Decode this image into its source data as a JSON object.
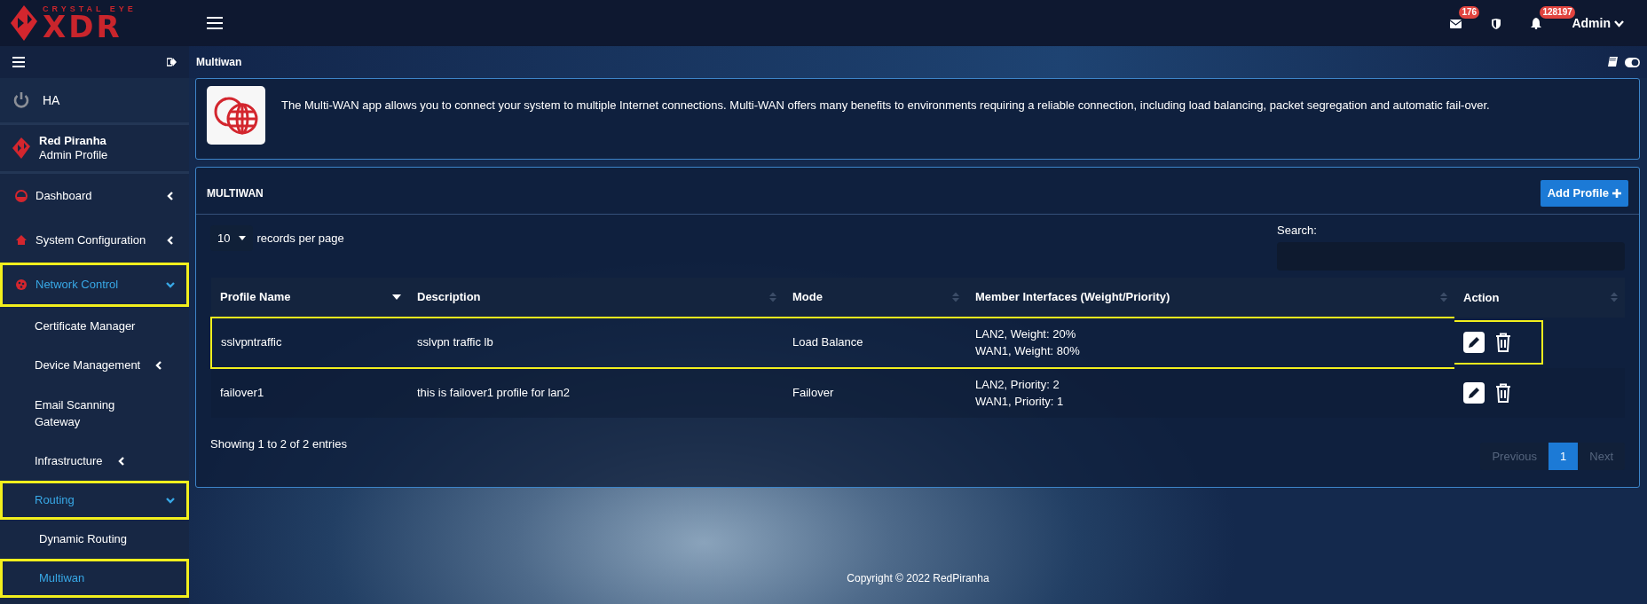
{
  "logo": {
    "tagline": "CRYSTAL EYE",
    "wordmark": "XDR"
  },
  "topbar": {
    "notifications": [
      {
        "kind": "mail",
        "count": "176"
      },
      {
        "kind": "shield"
      },
      {
        "kind": "bell",
        "count": "128197"
      }
    ],
    "user": "Admin"
  },
  "sidebar": {
    "ha_label": "HA",
    "profile": {
      "name": "Red Piranha",
      "role": "Admin Profile"
    },
    "items": [
      {
        "label": "Dashboard",
        "expanded": false,
        "selected": false,
        "highlighted": false
      },
      {
        "label": "System Configuration",
        "expanded": false,
        "selected": false,
        "highlighted": false
      },
      {
        "label": "Network Control",
        "expanded": true,
        "selected": true,
        "highlighted": true,
        "children": [
          {
            "label": "Certificate Manager",
            "selected": false,
            "highlighted": false
          },
          {
            "label": "Device Management",
            "expanded": false,
            "selected": false,
            "highlighted": false
          },
          {
            "label": "Email Scanning Gateway",
            "selected": false,
            "highlighted": false
          },
          {
            "label": "Infrastructure",
            "expanded": false,
            "selected": false,
            "highlighted": false
          },
          {
            "label": "Routing",
            "expanded": true,
            "selected": true,
            "highlighted": true,
            "children": [
              {
                "label": "Dynamic Routing",
                "selected": false,
                "highlighted": false
              },
              {
                "label": "Multiwan",
                "selected": true,
                "highlighted": true
              }
            ]
          }
        ]
      }
    ]
  },
  "page": {
    "title": "Multiwan",
    "info": "The Multi-WAN app allows you to connect your system to multiple Internet connections. Multi-WAN offers many benefits to environments requiring a reliable connection, including load balancing, packet segregation and automatic fail-over.",
    "panel": {
      "title": "MULTIWAN",
      "add_button": "Add Profile",
      "page_length": "10",
      "page_length_label": "records per page",
      "search_label": "Search:",
      "columns": [
        {
          "label": "Profile Name",
          "sorted": true
        },
        {
          "label": "Description",
          "sorted": false
        },
        {
          "label": "Mode",
          "sorted": false
        },
        {
          "label": "Member Interfaces (Weight/Priority)",
          "sorted": false
        },
        {
          "label": "Action",
          "sorted": false
        }
      ],
      "rows": [
        {
          "profile_name": "sslvpntraffic",
          "description": "sslvpn traffic lb",
          "mode": "Load Balance",
          "members": [
            "LAN2, Weight: 20%",
            "WAN1, Weight: 80%"
          ],
          "highlighted": true
        },
        {
          "profile_name": "failover1",
          "description": "this is failover1 profile for lan2",
          "mode": "Failover",
          "members": [
            "LAN2, Priority: 2",
            "WAN1, Priority: 1"
          ],
          "highlighted": false
        }
      ],
      "summary": "Showing 1 to 2 of 2 entries",
      "pagination": [
        {
          "label": "Previous",
          "disabled": true,
          "selected": false
        },
        {
          "label": "1",
          "disabled": false,
          "selected": true
        },
        {
          "label": "Next",
          "disabled": true,
          "selected": false
        }
      ]
    }
  },
  "footer": "Copyright © 2022 RedPiranha"
}
